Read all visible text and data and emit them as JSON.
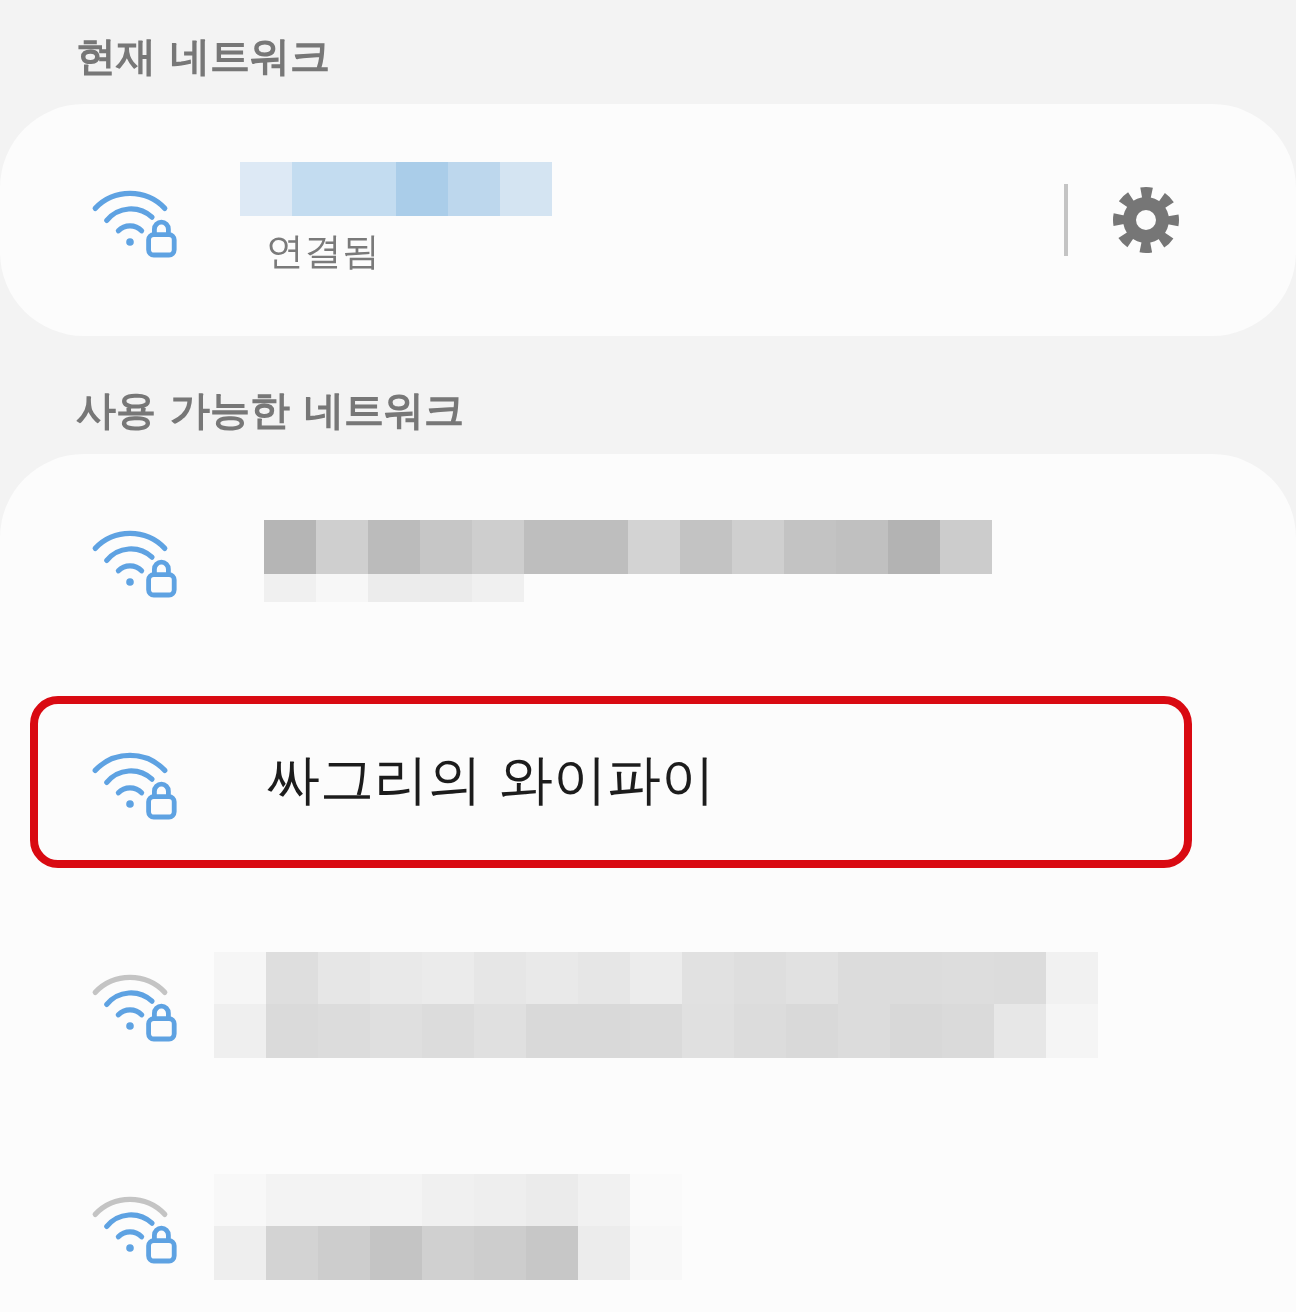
{
  "current_network": {
    "heading": "현재 네트워크",
    "network": {
      "kind": "hidden",
      "status": "연결됨",
      "full_signal": true
    }
  },
  "available_networks": {
    "heading": "사용 가능한 네트워크",
    "networks": [
      {
        "kind": "hidden",
        "full_signal": true,
        "highlighted": false
      },
      {
        "kind": "named",
        "name": "싸그리의 와이파이",
        "full_signal": true,
        "highlighted": true
      },
      {
        "kind": "hidden",
        "full_signal": false,
        "highlighted": false
      },
      {
        "kind": "hidden",
        "full_signal": false,
        "highlighted": false
      }
    ]
  }
}
